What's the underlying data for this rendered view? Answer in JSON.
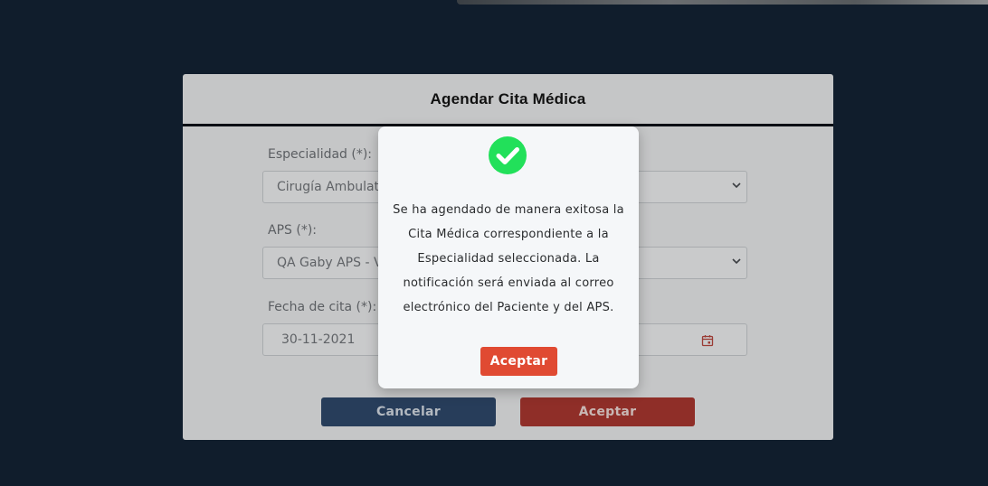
{
  "form": {
    "title": "Agendar Cita Médica",
    "especialidad": {
      "label": "Especialidad (*):",
      "value": "Cirugía Ambulat"
    },
    "aps": {
      "label": "APS (*):",
      "value": "QA Gaby APS - V"
    },
    "fecha": {
      "label": "Fecha de cita (*):",
      "value": "30-11-2021"
    },
    "cancel_label": "Cancelar",
    "accept_label": "Aceptar"
  },
  "modal": {
    "message": "Se ha agendado de manera exitosa la Cita Médica correspondiente a la Especialidad seleccionada. La notificación será enviada al correo electrónico del Paciente y del APS.",
    "accept_label": "Aceptar"
  },
  "colors": {
    "background": "#101d2c",
    "success": "#22e05a",
    "accent_red": "#e04a32",
    "cancel_blue": "#273d5a"
  },
  "icons": {
    "success": "check-circle-icon",
    "dropdown": "chevron-down-icon",
    "date": "calendar-icon"
  }
}
